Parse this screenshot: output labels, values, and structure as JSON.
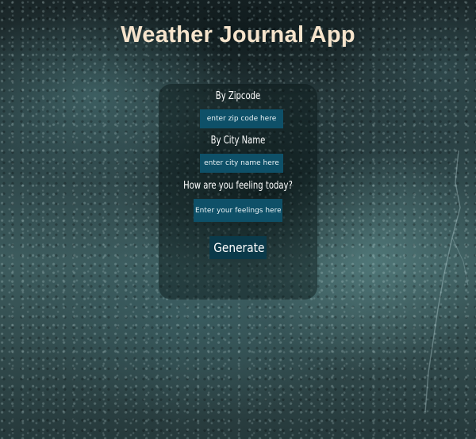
{
  "app": {
    "title": "Weather Journal App"
  },
  "form": {
    "zip_label": "By Zipcode",
    "zip_placeholder": "enter zip code here",
    "zip_value": "",
    "city_label": "By City Name",
    "city_placeholder": "enter city name here",
    "city_value": "",
    "feelings_label": "How are you feeling today?",
    "feelings_placeholder": "Enter your feelings here",
    "feelings_value": "",
    "generate_label": "Generate"
  },
  "colors": {
    "title_text": "#f6e4cc",
    "input_background": "#0e5068",
    "button_background": "#0b3a4a",
    "panel_overlay": "rgba(8,18,20,0.42)"
  }
}
